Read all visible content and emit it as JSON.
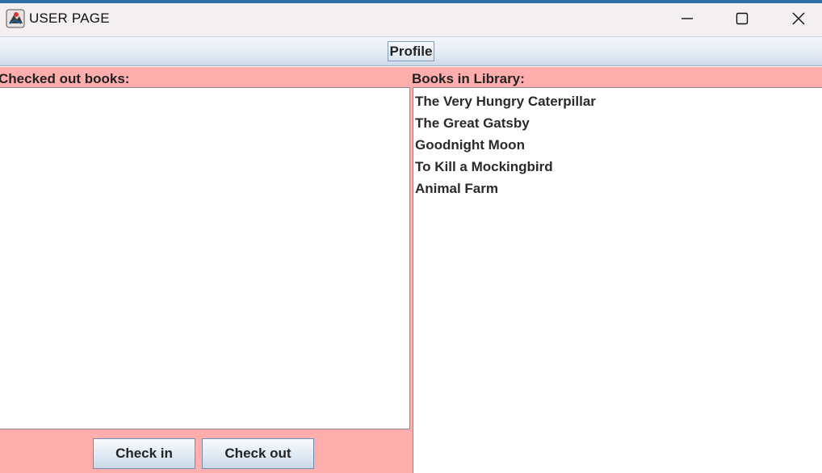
{
  "window": {
    "title": "USER PAGE",
    "minimize_icon": "minimize-icon",
    "maximize_icon": "maximize-icon",
    "close_icon": "close-icon"
  },
  "toolbar": {
    "profile_label": "Profile"
  },
  "checked_out": {
    "label": "Checked out books:",
    "items": []
  },
  "library": {
    "label": "Books in Library:",
    "items": [
      "The Very Hungry Caterpillar",
      "The Great Gatsby",
      "Goodnight Moon",
      "To Kill a Mockingbird",
      "Animal Farm"
    ]
  },
  "actions": {
    "check_in_label": "Check in",
    "check_out_label": "Check out"
  },
  "colors": {
    "panel_background": "#ffadad",
    "title_bar": "#f6efef",
    "window_accent": "#2d72ad"
  }
}
